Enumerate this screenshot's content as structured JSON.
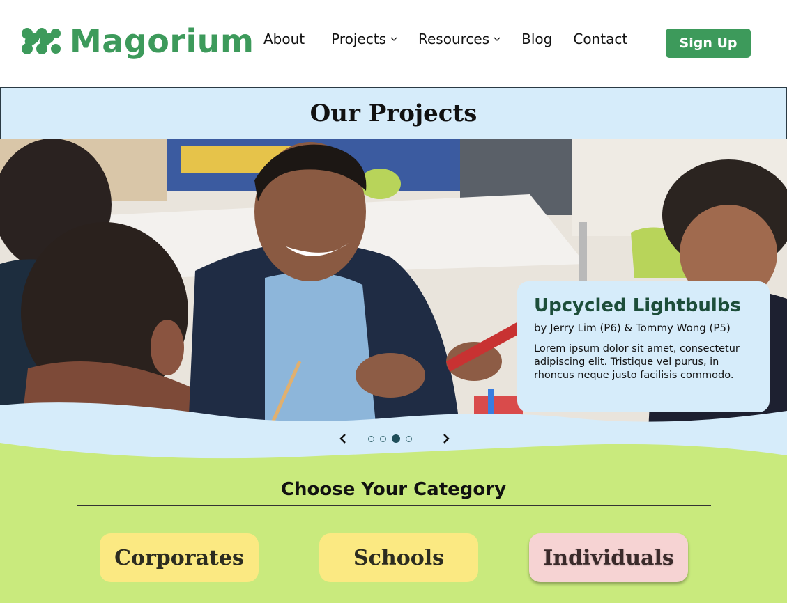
{
  "brand": {
    "name": "Magorium",
    "color": "#3d9a5b"
  },
  "nav": {
    "about": "About",
    "projects": "Projects",
    "resources": "Resources",
    "blog": "Blog",
    "contact": "Contact",
    "signup": "Sign Up"
  },
  "section": {
    "title": "Our Projects"
  },
  "carousel": {
    "slide": {
      "title": "Upcycled Lightbulbs",
      "byline": "by Jerry Lim (P6) & Tommy Wong (P5)",
      "description": "Lorem ipsum dolor sit amet, consectetur adipiscing elit. Tristique vel purus, in rhoncus neque justo facilisis commodo."
    },
    "total_slides": 4,
    "active_slide": 3,
    "prev_icon": "chevron-left-icon",
    "next_icon": "chevron-right-icon"
  },
  "categories": {
    "heading": "Choose Your Category",
    "items": [
      {
        "label": "Corporates"
      },
      {
        "label": "Schools"
      },
      {
        "label": "Individuals"
      }
    ]
  },
  "colors": {
    "sky": "#d6ecfa",
    "grass": "#c9ea7d",
    "yellow": "#fbe982",
    "pink": "#f6d3d3"
  }
}
